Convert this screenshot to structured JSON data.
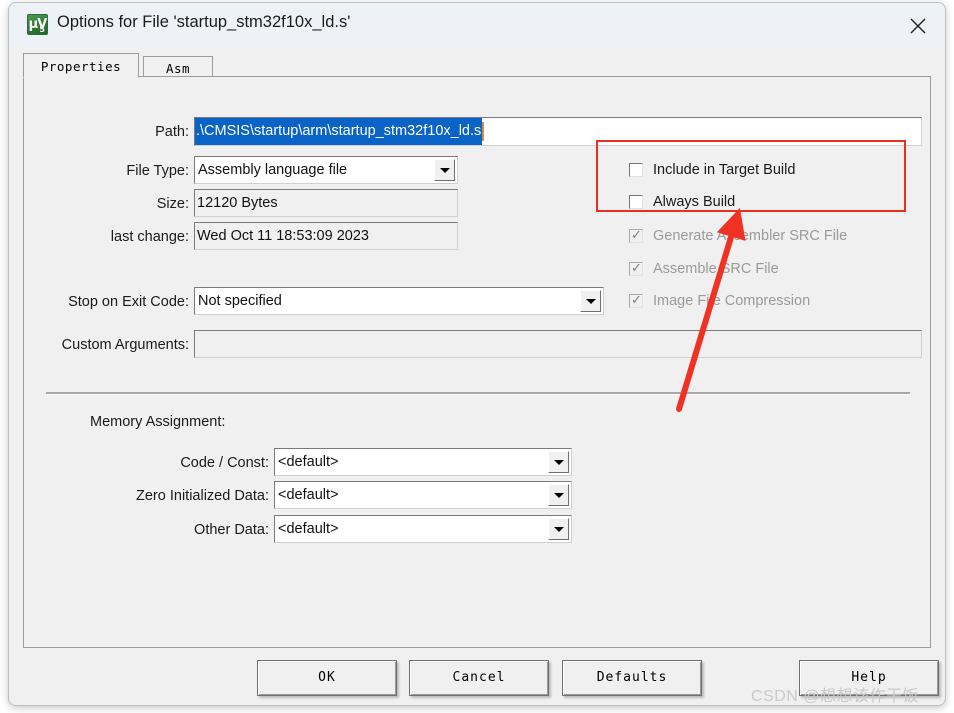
{
  "window": {
    "title": "Options for File 'startup_stm32f10x_ld.s'",
    "icon": "uvision-logo-icon",
    "close_label": "✕"
  },
  "tabs": [
    {
      "label": "Properties",
      "active": true
    },
    {
      "label": "Asm",
      "active": false
    }
  ],
  "fields": {
    "path": {
      "label": "Path:",
      "value": ".\\CMSIS\\startup\\arm\\startup_stm32f10x_ld.s",
      "selected": true
    },
    "file_type": {
      "label": "File Type:",
      "value": "Assembly language file"
    },
    "size": {
      "label": "Size:",
      "value": "12120 Bytes"
    },
    "last_change": {
      "label": "last change:",
      "value": "Wed Oct 11 18:53:09 2023"
    },
    "stop_on_exit_code": {
      "label": "Stop on Exit Code:",
      "value": "Not specified"
    },
    "custom_arguments": {
      "label": "Custom Arguments:",
      "value": ""
    }
  },
  "checkboxes": [
    {
      "label": "Include in Target Build",
      "checked": false,
      "disabled": false
    },
    {
      "label": "Always Build",
      "checked": false,
      "disabled": false
    },
    {
      "label": "Generate Assembler SRC File",
      "checked": true,
      "disabled": true
    },
    {
      "label": "Assemble SRC File",
      "checked": true,
      "disabled": true
    },
    {
      "label": "Image File Compression",
      "checked": true,
      "disabled": true
    }
  ],
  "memory_assignment": {
    "title": "Memory Assignment:",
    "rows": [
      {
        "label": "Code / Const:",
        "value": "<default>"
      },
      {
        "label": "Zero Initialized Data:",
        "value": "<default>"
      },
      {
        "label": "Other Data:",
        "value": "<default>"
      }
    ]
  },
  "buttons": [
    {
      "label": "OK"
    },
    {
      "label": "Cancel"
    },
    {
      "label": "Defaults"
    },
    {
      "label": "Help"
    }
  ],
  "annotation": {
    "highlight_color": "#e8301f",
    "arrow_color": "#f03224"
  },
  "watermark": "CSDN @想想该作干饭"
}
